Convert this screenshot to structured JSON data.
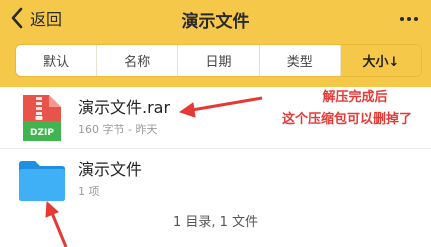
{
  "header": {
    "back_label": "返回",
    "title": "演示文件"
  },
  "sort": {
    "options": [
      "默认",
      "名称",
      "日期",
      "类型",
      "大小↓"
    ],
    "active_index": 4
  },
  "files": [
    {
      "name": "演示文件.rar",
      "meta": "160 字节 - 昨天",
      "icon": "dzip-archive-icon",
      "icon_label": "DZIP"
    },
    {
      "name": "演示文件",
      "meta": "1 项",
      "icon": "folder-icon"
    }
  ],
  "annotation": {
    "line1": "解压完成后",
    "line2": "这个压缩包可以删掉了",
    "color": "#e53935"
  },
  "summary": "1 目录, 1 文件",
  "colors": {
    "accent": "#f6c84a",
    "archive_red": "#e8534a",
    "archive_green": "#3fb44f",
    "folder_blue": "#2ea3f2"
  }
}
